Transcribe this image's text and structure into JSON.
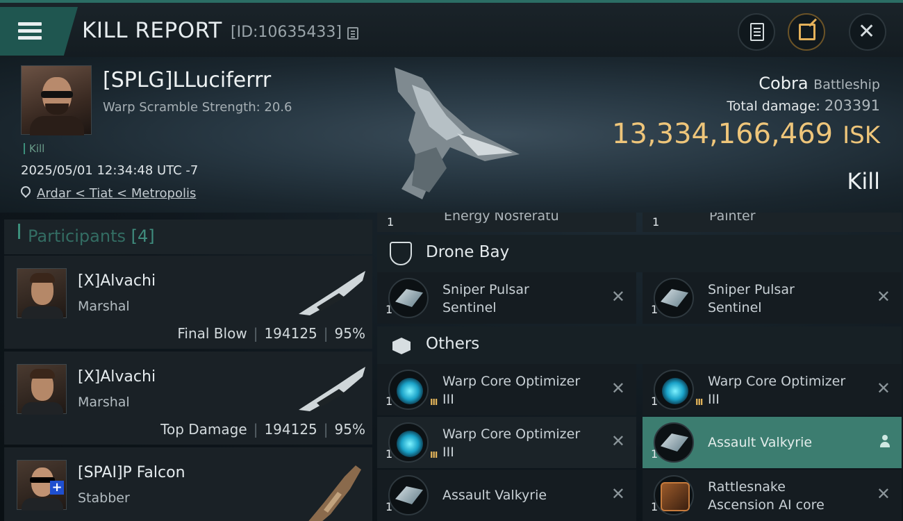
{
  "header": {
    "title": "KILL REPORT",
    "report_id": "[ID:10635433]"
  },
  "victim": {
    "name": "[SPLG]LLuciferrr",
    "scramble": "Warp Scramble Strength: 20.6",
    "tag": "Kill",
    "datetime": "2025/05/01 12:34:48 UTC -7",
    "location": "Ardar < Tiat < Metropolis",
    "ship": "Cobra",
    "ship_class": "Battleship",
    "damage_label": "Total damage:",
    "damage": "203391",
    "isk_value": "13,334,166,469",
    "isk_unit": "ISK",
    "result": "Kill"
  },
  "participants": {
    "label": "Participants",
    "count": "[4]",
    "list": [
      {
        "name": "[X]Alvachi",
        "ship": "Marshal",
        "role": "Final Blow",
        "damage": "194125",
        "percent": "95%"
      },
      {
        "name": "[X]Alvachi",
        "ship": "Marshal",
        "role": "Top Damage",
        "damage": "194125",
        "percent": "95%"
      },
      {
        "name": "[SPAI]P Falcon",
        "ship": "Stabber",
        "role": "",
        "damage": "",
        "percent": ""
      }
    ]
  },
  "modules": {
    "partial_left": {
      "qty": "1",
      "name": "Energy Nosferatu"
    },
    "partial_right": {
      "qty": "1",
      "name": "Painter"
    },
    "drone_bay_label": "Drone Bay",
    "others_label": "Others",
    "drone_bay": [
      {
        "qty": "1",
        "line1": "Sniper Pulsar",
        "line2": "Sentinel"
      },
      {
        "qty": "1",
        "line1": "Sniper Pulsar",
        "line2": "Sentinel"
      }
    ],
    "others": [
      {
        "qty": "1",
        "line1": "Warp Core Optimizer",
        "line2": "III",
        "tier": "III"
      },
      {
        "qty": "1",
        "line1": "Warp Core Optimizer",
        "line2": "III",
        "tier": "III"
      },
      {
        "qty": "1",
        "line1": "Warp Core Optimizer",
        "line2": "III",
        "tier": "III"
      },
      {
        "qty": "1",
        "line1": "Assault Valkyrie",
        "line2": ""
      },
      {
        "qty": "1",
        "line1": "Assault Valkyrie",
        "line2": ""
      },
      {
        "qty": "1",
        "line1": "Rattlesnake",
        "line2": "Ascension AI core"
      }
    ]
  },
  "colors": {
    "accent": "#3c8f7b",
    "isk": "#eec57a",
    "selected": "#3c7d70"
  }
}
